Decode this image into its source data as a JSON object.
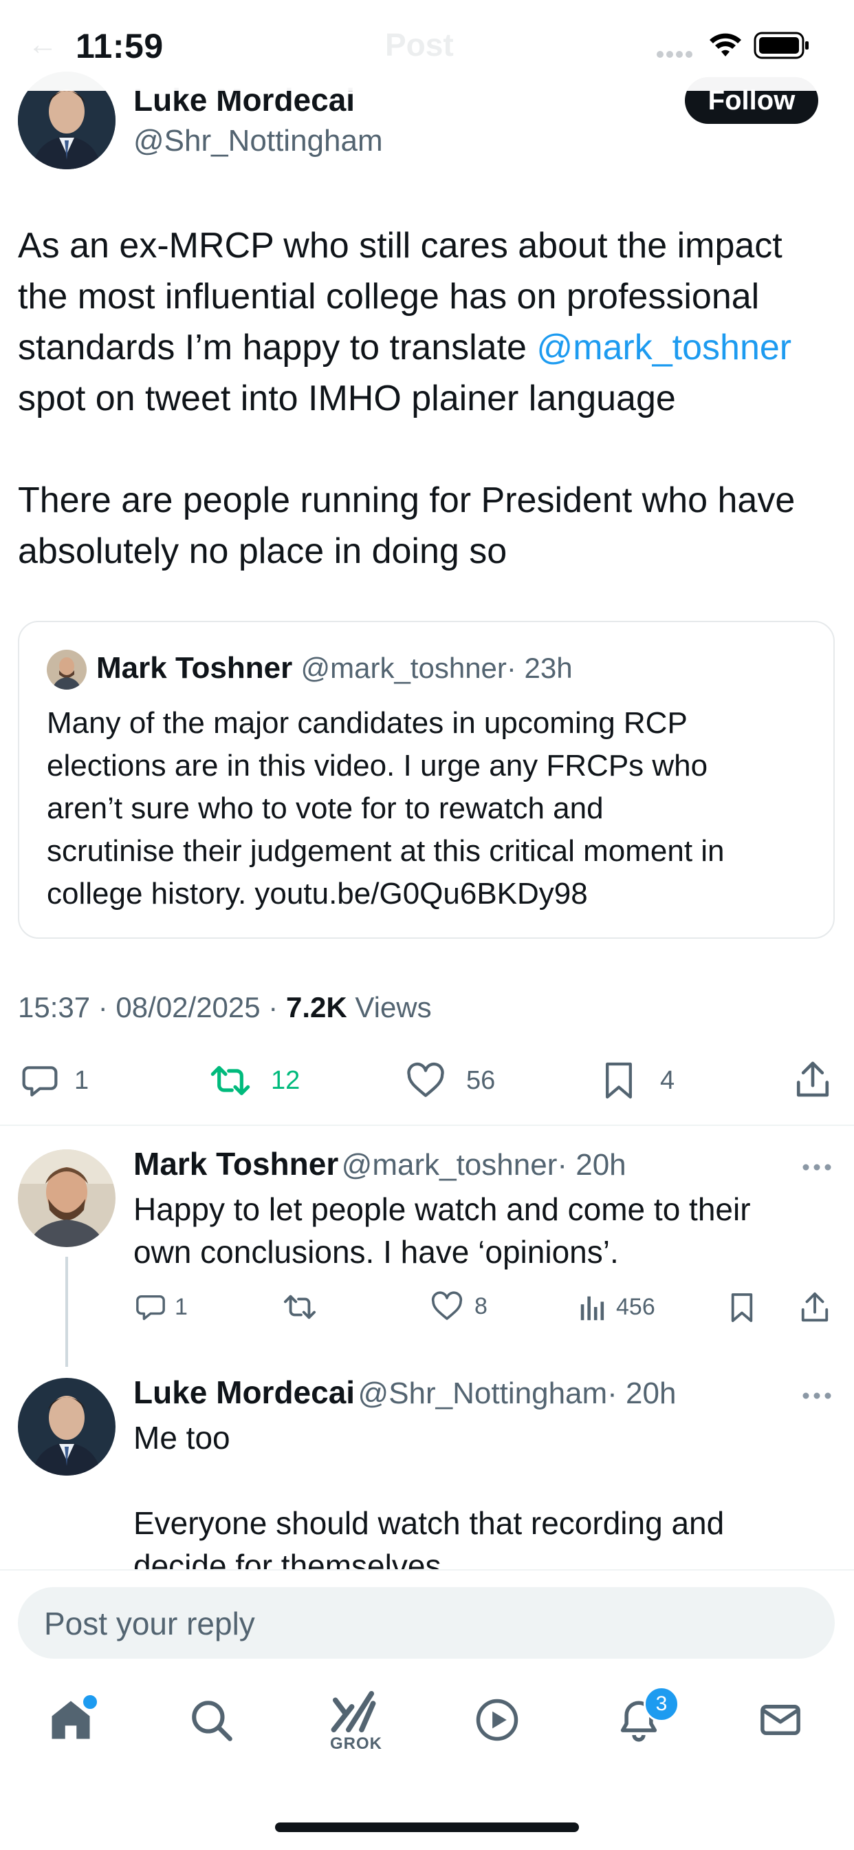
{
  "status_bar": {
    "time": "11:59",
    "faded_title": "Post"
  },
  "main_post": {
    "author_name": "Luke Mordecai",
    "author_handle": "@Shr_Nottingham",
    "follow_label": "Follow",
    "text_line1": "As an ex-MRCP who still cares about the impact",
    "text_line2": "the most influential college has on professional",
    "text_line3_prefix": "standards I’m happy to translate ",
    "text_line3_mention": "@mark_toshner",
    "text_line4": "spot on tweet into IMHO plainer language",
    "text_line5": "There are people running for President who have",
    "text_line6": "absolutely no place in doing so",
    "timestamp": "15:37 · 08/02/2025 · ",
    "views_count": "7.2K",
    "views_label": " Views",
    "replies": "1",
    "reposts": "12",
    "likes": "56",
    "bookmarks": "4"
  },
  "quoted_post": {
    "author_name": "Mark Toshner",
    "author_handle": "@mark_toshner",
    "time": "· 23h",
    "line1": "Many of the major candidates in upcoming RCP",
    "line2": "elections are in this video. I urge any FRCPs who",
    "line3": "aren’t sure who to vote for to rewatch and",
    "line4": "scrutinise their judgement at this critical moment in",
    "line5": "college history. youtu.be/G0Qu6BKDy98"
  },
  "replies": [
    {
      "author_name": "Mark Toshner",
      "author_handle": "@mark_toshner",
      "time": "· 20h",
      "line1": "Happy to let people watch  and come to their",
      "line2": "own conclusions. I have ‘opinions’.",
      "replies": "1",
      "likes": "8",
      "views": "456"
    },
    {
      "author_name": "Luke Mordecai",
      "author_handle": "@Shr_Nottingham",
      "time": "· 20h",
      "line1": "Me too",
      "line2": "Everyone should watch that recording and",
      "line3": "decide for themselves"
    }
  ],
  "reply_input": {
    "placeholder": "Post your reply"
  },
  "tab_bar": {
    "grok_label": "GROK",
    "notifications_badge": "3",
    "icons": [
      "home-icon",
      "search-icon",
      "grok-icon",
      "video-icon",
      "bell-icon",
      "mail-icon"
    ]
  },
  "colors": {
    "accent": "#1d9bf0",
    "repost_green": "#00ba7c",
    "text": "#0f1419",
    "muted": "#536471"
  }
}
